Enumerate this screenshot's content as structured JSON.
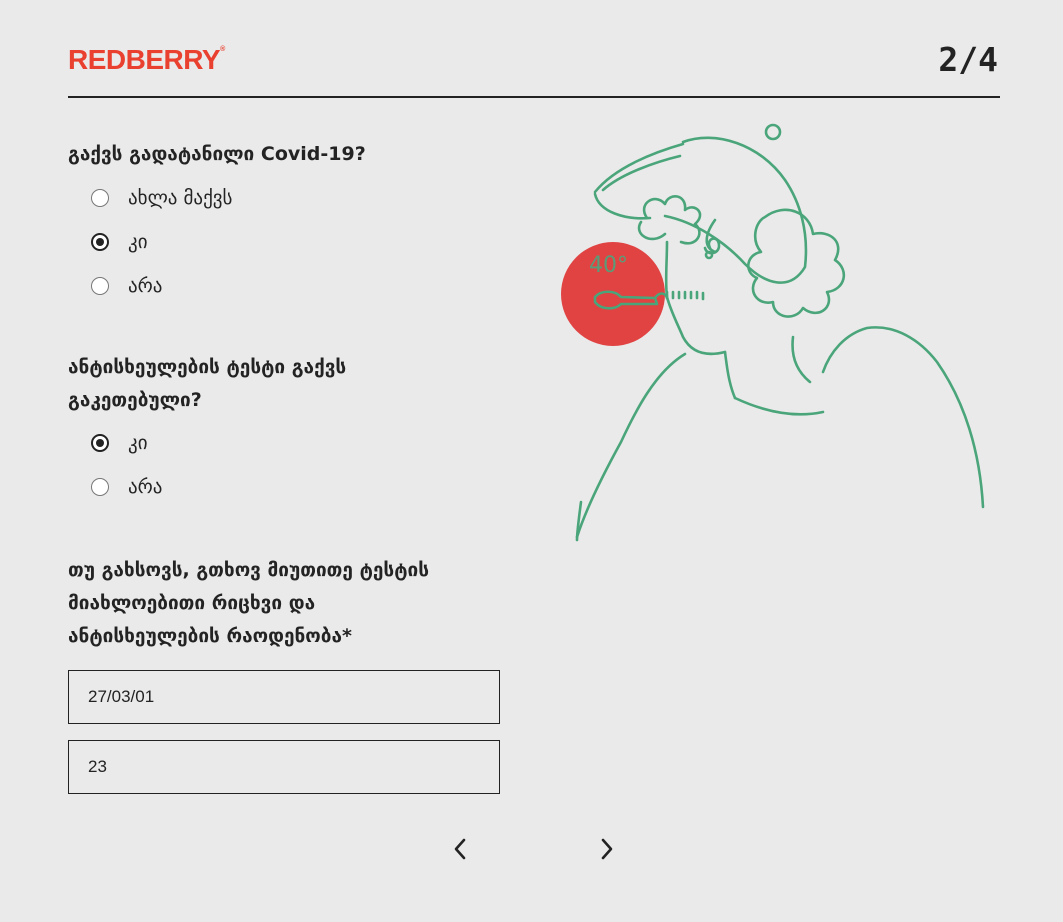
{
  "header": {
    "logo_text": "REDBERRY",
    "logo_mark": "®",
    "step_indicator": "2/4"
  },
  "questions": [
    {
      "label": "გაქვს გადატანილი Covid-19?",
      "options": [
        "ახლა მაქვს",
        "კი",
        "არა"
      ],
      "selected": "კი"
    },
    {
      "label_lines": [
        "ანტისხეულების ტესტი გაქვს",
        "გაკეთებული?"
      ],
      "options": [
        "კი",
        "არა"
      ],
      "selected": "კი"
    },
    {
      "label_lines": [
        "თუ გახსოვს, გთხოვ მიუთითე ტესტის",
        "მიახლოებითი რიცხვი და",
        "ანტისხეულების რაოდენობა*"
      ],
      "inputs": [
        {
          "value": "27/03/01"
        },
        {
          "value": "23"
        }
      ]
    }
  ],
  "illustration": {
    "thermometer_text": "40°",
    "colors": {
      "accent": "#e9402f",
      "circle": "#e03a3a",
      "line": "#4aa57a"
    }
  },
  "nav": {
    "prev_icon": "chevron-left-icon",
    "next_icon": "chevron-right-icon"
  }
}
